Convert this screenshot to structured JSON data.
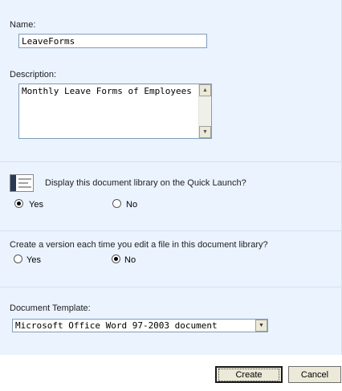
{
  "name": {
    "label": "Name:",
    "value": "LeaveForms"
  },
  "description": {
    "label": "Description:",
    "value": "Monthly Leave Forms of Employees"
  },
  "quick_launch": {
    "question": "Display this document library on the Quick Launch?",
    "options": [
      {
        "label": "Yes",
        "checked": true
      },
      {
        "label": "No",
        "checked": false
      }
    ]
  },
  "versioning": {
    "question": "Create a version each time you edit a file in this document library?",
    "options": [
      {
        "label": "Yes",
        "checked": false
      },
      {
        "label": "No",
        "checked": true
      }
    ]
  },
  "template": {
    "label": "Document Template:",
    "selected": "Microsoft Office Word 97-2003 document"
  },
  "buttons": {
    "create": "Create",
    "cancel": "Cancel"
  }
}
